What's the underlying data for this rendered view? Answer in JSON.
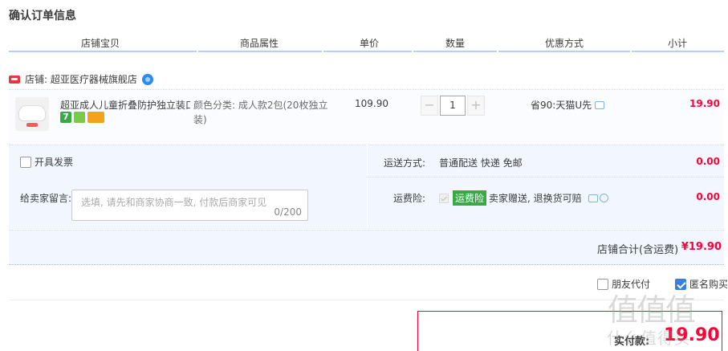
{
  "page": {
    "title": "确认订单信息"
  },
  "columns": [
    "店铺宝贝",
    "商品属性",
    "单价",
    "数量",
    "优惠方式",
    "小计"
  ],
  "store": {
    "name": "店铺: 超亚医疗器械旗舰店"
  },
  "item": {
    "name": "超亚成人儿童折叠防护独立装口...",
    "badge_7": "7",
    "attr_line1": "颜色分类:  成人款2包(20枚独立",
    "attr_line2": "装)",
    "price": "109.90",
    "quantity": "1",
    "minus": "−",
    "plus": "+",
    "promo": "省90:天猫U先",
    "subtotal": "19.90"
  },
  "options": {
    "invoice_label": "开具发票",
    "shipping_label": "运送方式:",
    "shipping_value": "普通配送 快递 免邮",
    "shipping_cost": "0.00",
    "message_label": "给卖家留言:",
    "message_placeholder": "选填, 请先和商家协商一致, 付款后商家可见",
    "message_count": "0/200",
    "insurance_label": "运费险:",
    "insurance_badge": "运费险",
    "insurance_text": "卖家赠送, 退换货可赔",
    "insurance_cost": "0.00"
  },
  "total": {
    "label": "店铺合计(含运费)",
    "value": "¥19.90"
  },
  "footer": {
    "friend_pay": "朋友代付",
    "anonymous": "匿名购买",
    "anonymous_checked": true,
    "pay_label": "实付款:",
    "pay_value": "19.90"
  },
  "watermark": {
    "big": "值值值",
    "small": "什么值得买"
  },
  "colors": {
    "accent": "#ff0036",
    "header_line": "#b2d1ff",
    "panel_bg": "#f2f7ff",
    "checkbox": "#3a7fde"
  }
}
